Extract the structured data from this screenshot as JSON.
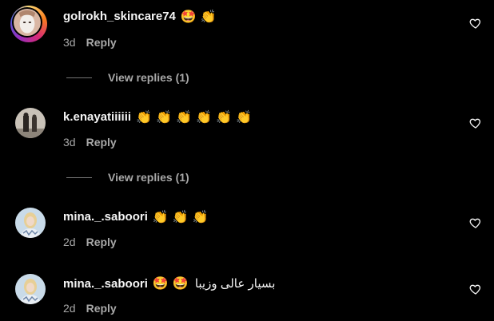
{
  "comments": [
    {
      "username": "golrokh_skincare74",
      "text": "🤩 👏",
      "time": "3d",
      "reply_label": "Reply",
      "view_replies": "View replies (1)"
    },
    {
      "username": "k.enayatiiiiii",
      "text": "👏 👏 👏 👏 👏 👏",
      "time": "3d",
      "reply_label": "Reply",
      "view_replies": "View replies (1)"
    },
    {
      "username": "mina._.saboori",
      "text": "👏 👏 👏",
      "time": "2d",
      "reply_label": "Reply"
    },
    {
      "username": "mina._.saboori",
      "text": "🤩 🤩",
      "text_rtl": "بسیار عالی وزیبا",
      "time": "2d",
      "reply_label": "Reply"
    }
  ],
  "icons": {
    "like": "heart-outline-icon",
    "avatar_ring": "story-ring"
  },
  "colors": {
    "background": "#000000",
    "primary_text": "#f5f5f5",
    "secondary_text": "#a8a8a8"
  }
}
